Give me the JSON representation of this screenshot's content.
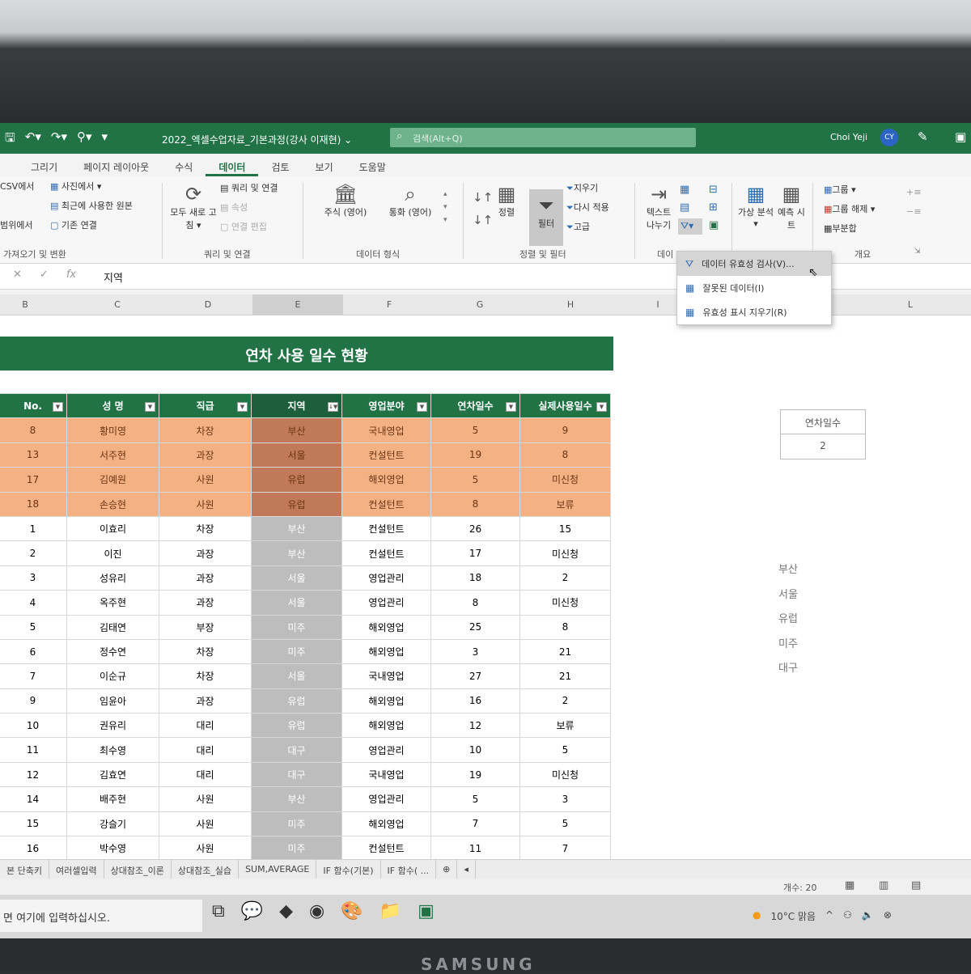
{
  "window": {
    "title": "2022_엑셀수업자료_기본과정(강사 이재현) ⌄",
    "search_placeholder": "검색(Alt+Q)",
    "user_name": "Choi Yeji",
    "user_initials": "CY"
  },
  "tabs": [
    "그리기",
    "페이지 레이아웃",
    "수식",
    "데이터",
    "검토",
    "보기",
    "도움말"
  ],
  "active_tab": "데이터",
  "ribbon": {
    "get_data": [
      "CSV에서",
      "범위에서",
      "사진에서 ▾",
      "최근에 사용한 원본",
      "기존 연결"
    ],
    "get_data_group": "가져오기 및 변환",
    "queries": [
      "모두 새로 고침 ▾",
      "쿼리 및 연결",
      "속성",
      "연결 편집"
    ],
    "queries_group": "쿼리 및 연결",
    "data_types": [
      "주식 (영어)",
      "통화 (영어)"
    ],
    "data_types_group": "데이터 형식",
    "sort": "정렬",
    "filter": "필터",
    "filter_options": [
      "지우기",
      "다시 적용",
      "고급"
    ],
    "sort_filter_group": "정렬 및 필터",
    "text_to_columns": "텍스트 나누기",
    "data_tools_group": "데이",
    "forecast": [
      "가상 분석 ▾",
      "예측 시트"
    ],
    "outline": [
      "그룹 ▾",
      "그룹 해제 ▾",
      "부분합"
    ],
    "outline_group": "개요"
  },
  "validation_menu": {
    "items": [
      "데이터 유효성 검사(V)...",
      "잘못된 데이터(I)",
      "유효성 표시 지우기(R)"
    ]
  },
  "formula_bar": {
    "value": "지역"
  },
  "columns": [
    "B",
    "C",
    "D",
    "E",
    "F",
    "G",
    "H",
    "I",
    "L"
  ],
  "sheet": {
    "banner": "연차 사용 일수 현황",
    "headers": [
      "No.",
      "성 명",
      "직급",
      "지역",
      "영업분야",
      "연차일수",
      "실제사용일수"
    ],
    "rows": [
      {
        "no": "8",
        "name": "황미영",
        "rank": "차장",
        "region": "부산",
        "field": "국내영업",
        "days": "5",
        "used": "9",
        "hl": true
      },
      {
        "no": "13",
        "name": "서주현",
        "rank": "과장",
        "region": "서울",
        "field": "컨설턴트",
        "days": "19",
        "used": "8",
        "hl": true
      },
      {
        "no": "17",
        "name": "김예원",
        "rank": "사원",
        "region": "유럽",
        "field": "해외영업",
        "days": "5",
        "used": "미신청",
        "hl": true
      },
      {
        "no": "18",
        "name": "손승현",
        "rank": "사원",
        "region": "유럽",
        "field": "컨설턴트",
        "days": "8",
        "used": "보류",
        "hl": true
      },
      {
        "no": "1",
        "name": "이효리",
        "rank": "차장",
        "region": "부산",
        "field": "컨설턴트",
        "days": "26",
        "used": "15",
        "hl": false
      },
      {
        "no": "2",
        "name": "이진",
        "rank": "과장",
        "region": "부산",
        "field": "컨설턴트",
        "days": "17",
        "used": "미신청",
        "hl": false
      },
      {
        "no": "3",
        "name": "성유리",
        "rank": "과장",
        "region": "서울",
        "field": "영업관리",
        "days": "18",
        "used": "2",
        "hl": false
      },
      {
        "no": "4",
        "name": "옥주현",
        "rank": "과장",
        "region": "서울",
        "field": "영업관리",
        "days": "8",
        "used": "미신청",
        "hl": false
      },
      {
        "no": "5",
        "name": "김태연",
        "rank": "부장",
        "region": "미주",
        "field": "해외영업",
        "days": "25",
        "used": "8",
        "hl": false
      },
      {
        "no": "6",
        "name": "정수연",
        "rank": "차장",
        "region": "미주",
        "field": "해외영업",
        "days": "3",
        "used": "21",
        "hl": false
      },
      {
        "no": "7",
        "name": "이순규",
        "rank": "차장",
        "region": "서울",
        "field": "국내영업",
        "days": "27",
        "used": "21",
        "hl": false
      },
      {
        "no": "9",
        "name": "임윤아",
        "rank": "과장",
        "region": "유럽",
        "field": "해외영업",
        "days": "16",
        "used": "2",
        "hl": false
      },
      {
        "no": "10",
        "name": "권유리",
        "rank": "대리",
        "region": "유럽",
        "field": "해외영업",
        "days": "12",
        "used": "보류",
        "hl": false
      },
      {
        "no": "11",
        "name": "최수영",
        "rank": "대리",
        "region": "대구",
        "field": "영업관리",
        "days": "10",
        "used": "5",
        "hl": false
      },
      {
        "no": "12",
        "name": "김효연",
        "rank": "대리",
        "region": "대구",
        "field": "국내영업",
        "days": "19",
        "used": "미신청",
        "hl": false
      },
      {
        "no": "14",
        "name": "배주현",
        "rank": "사원",
        "region": "부산",
        "field": "영업관리",
        "days": "5",
        "used": "3",
        "hl": false
      },
      {
        "no": "15",
        "name": "강슬기",
        "rank": "사원",
        "region": "미주",
        "field": "해외영업",
        "days": "7",
        "used": "5",
        "hl": false
      },
      {
        "no": "16",
        "name": "박수영",
        "rank": "사원",
        "region": "미주",
        "field": "컨설턴트",
        "days": "11",
        "used": "7",
        "hl": false
      }
    ],
    "side_header": "연차일수",
    "side_value": "2",
    "region_list": [
      "부산",
      "서울",
      "유럽",
      "미주",
      "대구"
    ]
  },
  "sheet_tabs": [
    "본 단축키",
    "여러셀입력",
    "상대참조_이론",
    "상대참조_실습",
    "SUM,AVERAGE",
    "IF 함수(기본)",
    "IF 함수( ..."
  ],
  "status": {
    "count": "개수: 20"
  },
  "taskbar": {
    "search_text": "면 여기에 입력하십시오.",
    "weather": "10°C 맑음"
  },
  "brand": "SAMSUNG",
  "colors": {
    "excel_green": "#217346",
    "highlight_orange": "#f4b183",
    "selected_column": "#bdbdbd"
  }
}
